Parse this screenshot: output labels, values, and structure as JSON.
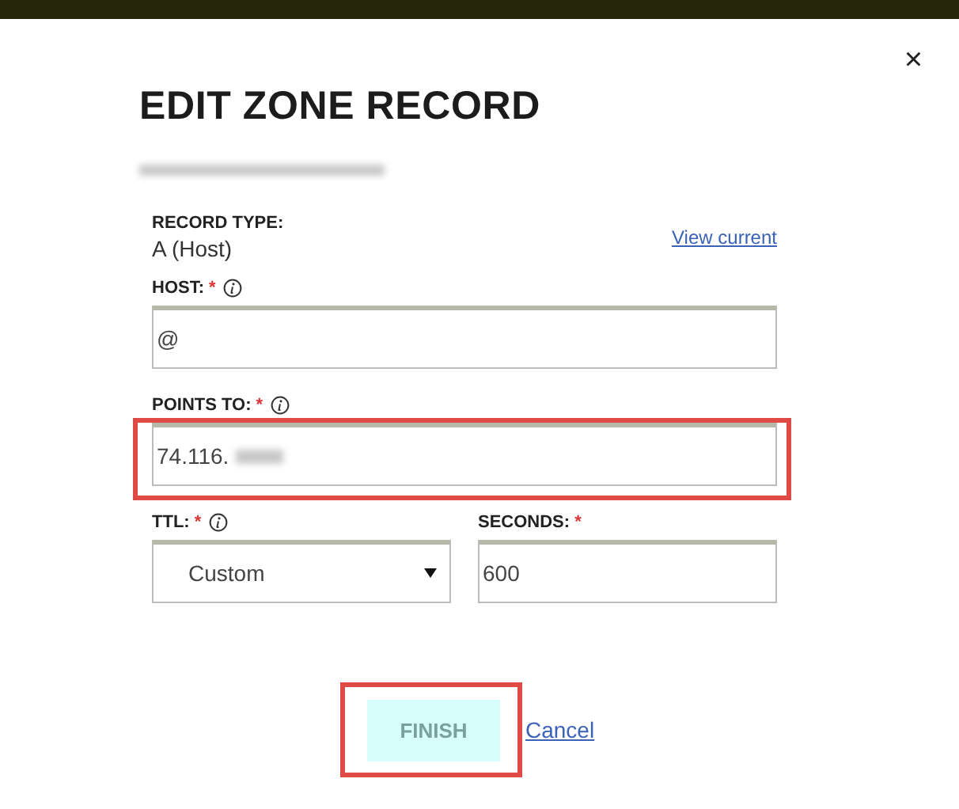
{
  "dialog": {
    "title": "EDIT ZONE RECORD",
    "close": "×"
  },
  "record_type": {
    "label": "RECORD TYPE:",
    "value": "A (Host)",
    "link": "View current"
  },
  "host": {
    "label": "HOST:",
    "required": "*",
    "info": true,
    "value": "@",
    "highlighted": false
  },
  "points_to": {
    "label": "POINTS TO:",
    "required": "*",
    "info": true,
    "value": "74.116.",
    "highlighted": true
  },
  "ttl": {
    "label": "TTL:",
    "required": "*",
    "info": true,
    "value": "Custom"
  },
  "seconds": {
    "label": "SECONDS:",
    "required": "*",
    "info": false,
    "value": "600"
  },
  "finish": {
    "label": "FINISH",
    "disabled": true,
    "highlighted": true
  },
  "cancel": {
    "label": "Cancel"
  }
}
